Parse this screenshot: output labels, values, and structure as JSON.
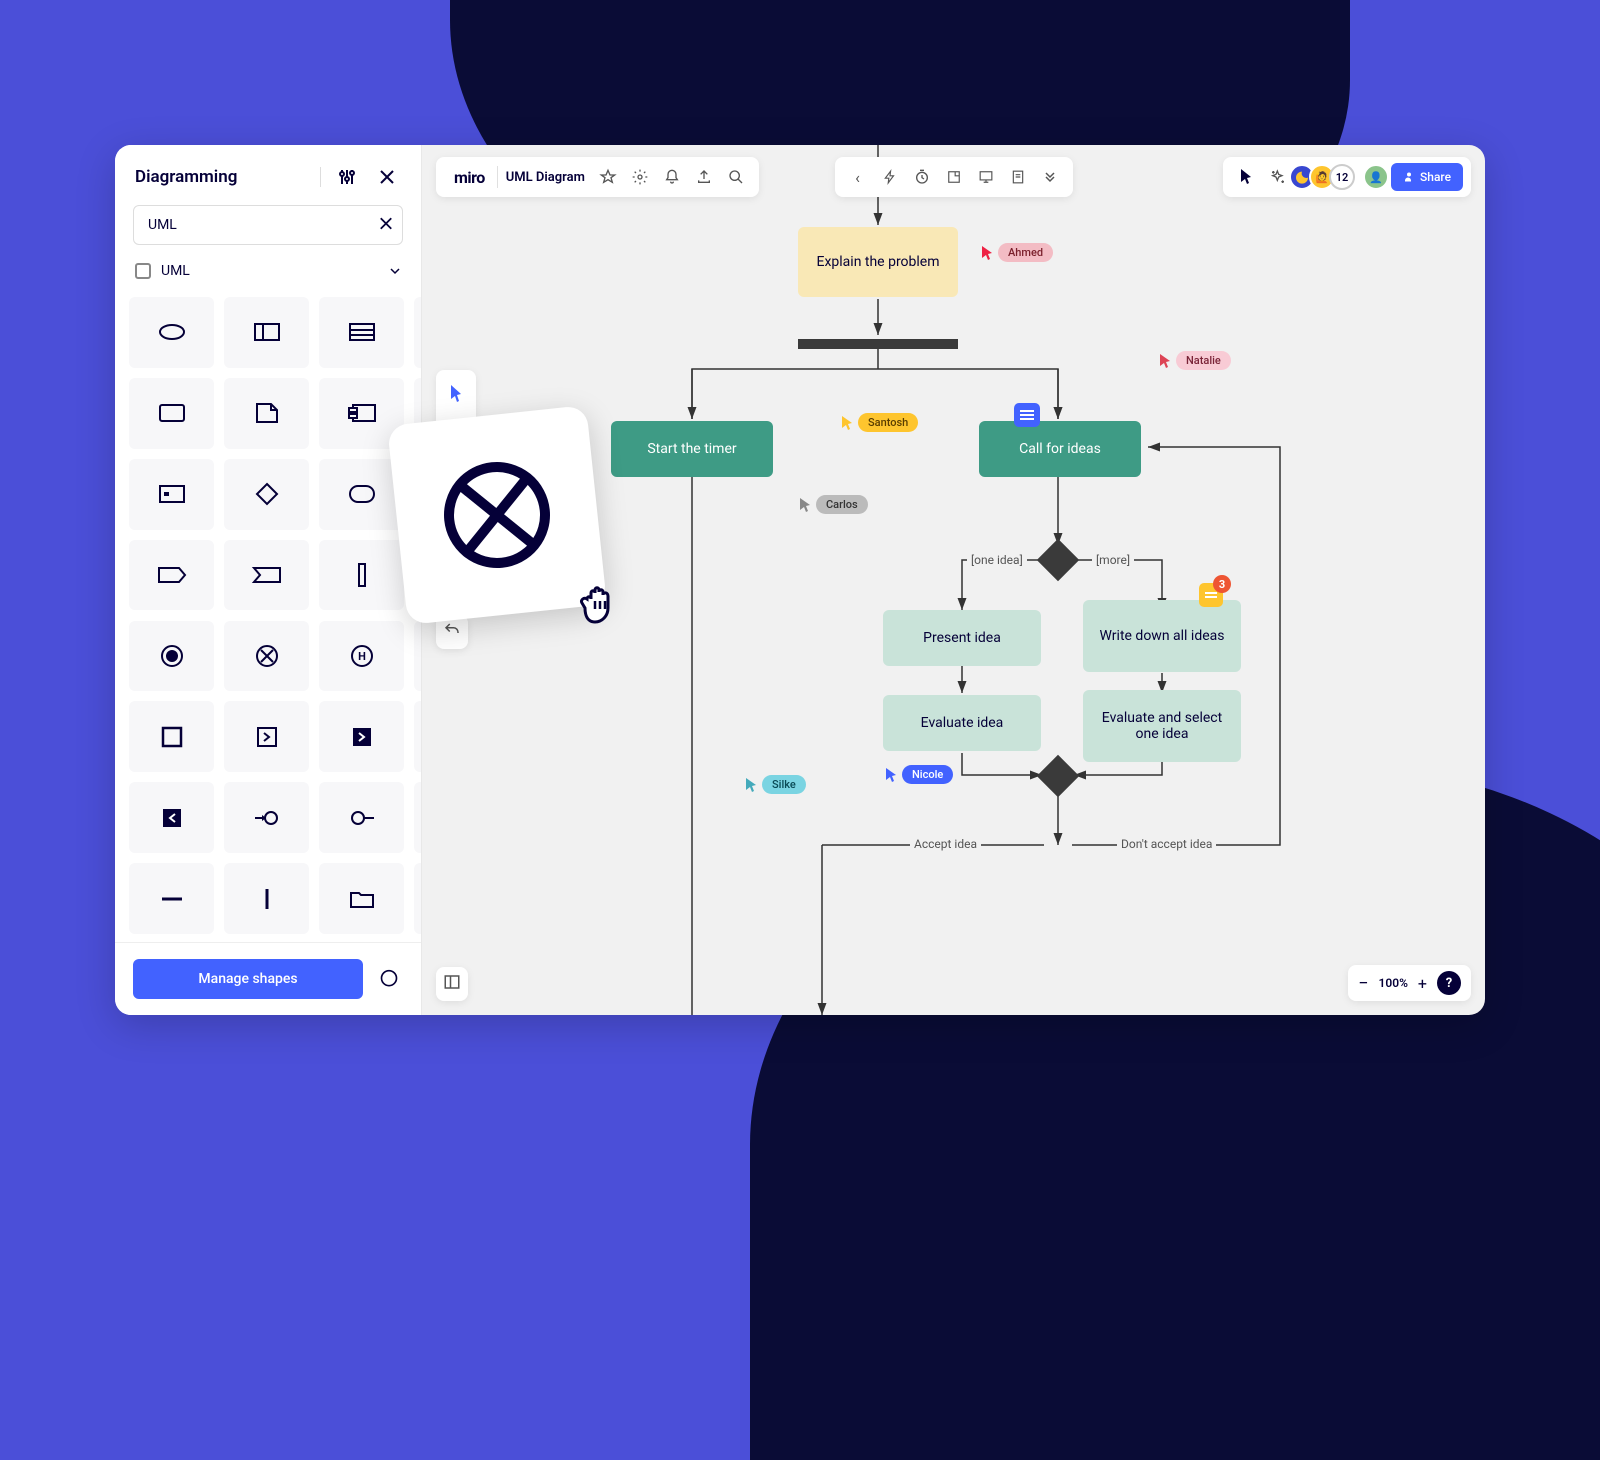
{
  "sidebar": {
    "title": "Diagramming",
    "search_value": "UML",
    "category_label": "UML",
    "manage_label": "Manage shapes"
  },
  "header": {
    "logo": "miro",
    "doc_name": "UML Diagram",
    "participant_count": "12",
    "share_label": "Share"
  },
  "zoom": {
    "value": "100%"
  },
  "diagram": {
    "node_explain": "Explain the problem",
    "node_start": "Start the timer",
    "node_call": "Call for ideas",
    "node_present": "Present idea",
    "node_evaluate": "Evaluate idea",
    "node_writedown": "Write down all ideas",
    "node_evalselect": "Evaluate and select one idea",
    "label_oneidea": "[one idea]",
    "label_more": "[more]",
    "label_accept": "Accept idea",
    "label_dontaccept": "Don't accept idea"
  },
  "cursors": {
    "ahmed": "Ahmed",
    "natalie": "Natalie",
    "santosh": "Santosh",
    "carlos": "Carlos",
    "nicole": "Nicole",
    "silke": "Silke"
  },
  "comment_count": "3"
}
